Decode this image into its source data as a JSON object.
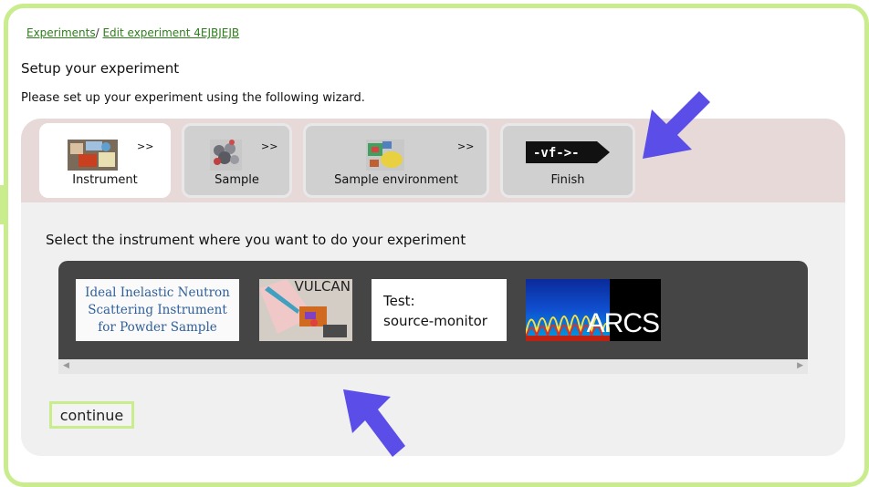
{
  "breadcrumb": {
    "experiments": "Experiments",
    "separator": "/",
    "edit": "Edit experiment 4EJBJEJB"
  },
  "header": {
    "title": "Setup your experiment",
    "description": "Please set up your experiment using the following wizard."
  },
  "wizard": {
    "steps": [
      {
        "label": "Instrument",
        "arrow": ">>",
        "active": true
      },
      {
        "label": "Sample",
        "arrow": ">>",
        "active": false
      },
      {
        "label": "Sample environment",
        "arrow": ">>",
        "active": false
      },
      {
        "label": "Finish",
        "active": false
      }
    ],
    "finish_icon_text": "-vf->-",
    "instruction": "Select the instrument where you want to do your experiment"
  },
  "instruments": {
    "ideal": {
      "lines": [
        "Ideal Inelastic Neutron",
        "Scattering Instrument",
        "for Powder Sample"
      ]
    },
    "vulcan": {
      "name": "VULCAN"
    },
    "test": {
      "line1": "Test:",
      "line2": "source-monitor"
    },
    "arcs": {
      "name": "ARCS"
    }
  },
  "scrollbar": {
    "left": "◀",
    "right": "▶"
  },
  "continue_label": "continue",
  "colors": {
    "frame": "#c9ec8c",
    "wizard_top": "#e8d9d9",
    "carousel": "#454545",
    "pointer": "#5b4ee8"
  }
}
